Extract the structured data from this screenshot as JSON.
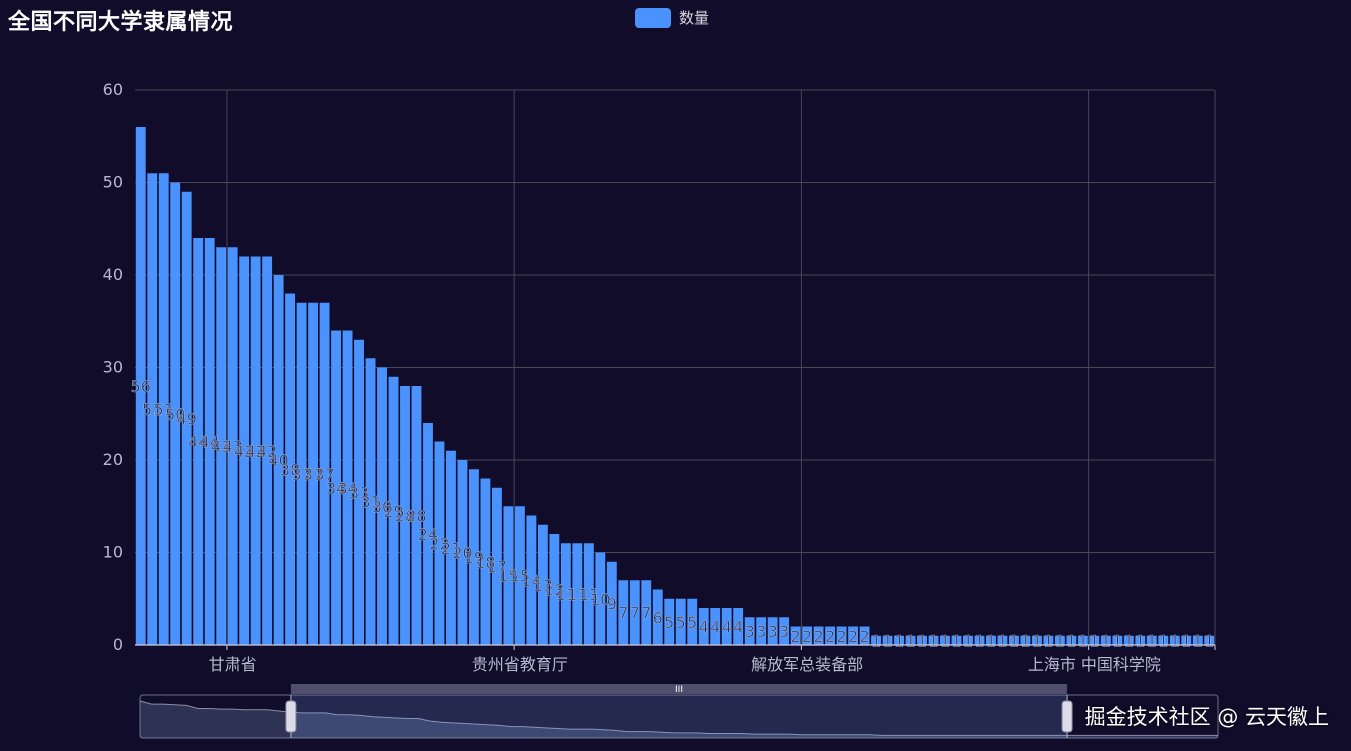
{
  "chart_data": {
    "type": "bar",
    "title": "全国不同大学隶属情况",
    "xlabel": "",
    "ylabel": "",
    "ylim": [
      0,
      60
    ],
    "yticks": [
      0,
      10,
      20,
      30,
      40,
      50,
      60
    ],
    "grid": true,
    "legend_position": "top-center",
    "category_count": 94,
    "tick_labels": [
      {
        "index": 8,
        "label": "甘肃省"
      },
      {
        "index": 33,
        "label": "贵州省教育厅"
      },
      {
        "index": 58,
        "label": "解放军总装备部"
      },
      {
        "index": 83,
        "label": "上海市 中国科学院"
      }
    ],
    "series": [
      {
        "name": "数量",
        "color": "#4992ff",
        "values": [
          56,
          51,
          51,
          50,
          49,
          44,
          44,
          43,
          43,
          42,
          42,
          42,
          40,
          38,
          37,
          37,
          37,
          34,
          34,
          33,
          31,
          30,
          29,
          28,
          28,
          24,
          22,
          21,
          20,
          19,
          18,
          17,
          15,
          15,
          14,
          13,
          12,
          11,
          11,
          11,
          10,
          9,
          7,
          7,
          7,
          6,
          5,
          5,
          5,
          4,
          4,
          4,
          4,
          3,
          3,
          3,
          3,
          2,
          2,
          2,
          2,
          2,
          2,
          2,
          1,
          1,
          1,
          1,
          1,
          1,
          1,
          1,
          1,
          1,
          1,
          1,
          1,
          1,
          1,
          1,
          1,
          1,
          1,
          1,
          1,
          1,
          1,
          1,
          1,
          1,
          1,
          1,
          1,
          1
        ]
      }
    ],
    "datazoom": {
      "start_percent": 14,
      "end_percent": 86,
      "handle_label": "III"
    }
  },
  "watermark": "掘金技术社区 @ 云天徽上",
  "colors": {
    "background": "#100c2a",
    "bar": "#4992ff",
    "grid": "#484753",
    "axis_text": "#b9b8ce"
  }
}
